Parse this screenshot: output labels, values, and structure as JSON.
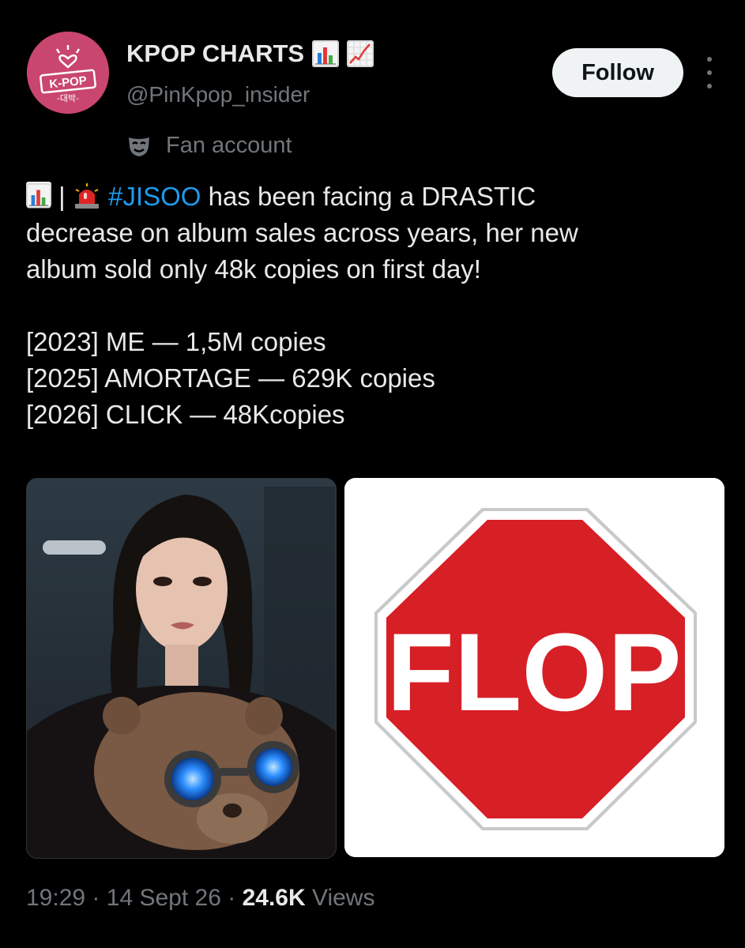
{
  "account": {
    "display_name": "KPOP CHARTS",
    "name_emojis": [
      "bar-chart-emoji",
      "chart-increasing-emoji"
    ],
    "handle": "@PinKpop_insider",
    "label": "Fan account",
    "avatar_text": "K-POP",
    "avatar_subtext": "대박"
  },
  "actions": {
    "follow_label": "Follow"
  },
  "tweet": {
    "prefix_separator": "|",
    "hashtag": "#JISOO",
    "line1_rest": "has been facing a DRASTIC",
    "line2": "decrease on album sales across years, her new",
    "line3": "album sold only 48k copies on first day!",
    "list": [
      "[2023] ME — 1,5M copies",
      "[2025] AMORTAGE — 629K copies",
      "[2026] CLICK — 48Kcopies"
    ]
  },
  "media": {
    "stop_sign_text": "FLOP"
  },
  "meta": {
    "time": "19:29",
    "date": "14 Sept 26",
    "views_count": "24.6K",
    "views_label": "Views",
    "separator": "·"
  },
  "colors": {
    "background": "#000000",
    "text": "#e7e9ea",
    "muted": "#71767b",
    "link": "#1d9bf0",
    "avatar": "#c9466f",
    "stop_red": "#d71f26"
  }
}
